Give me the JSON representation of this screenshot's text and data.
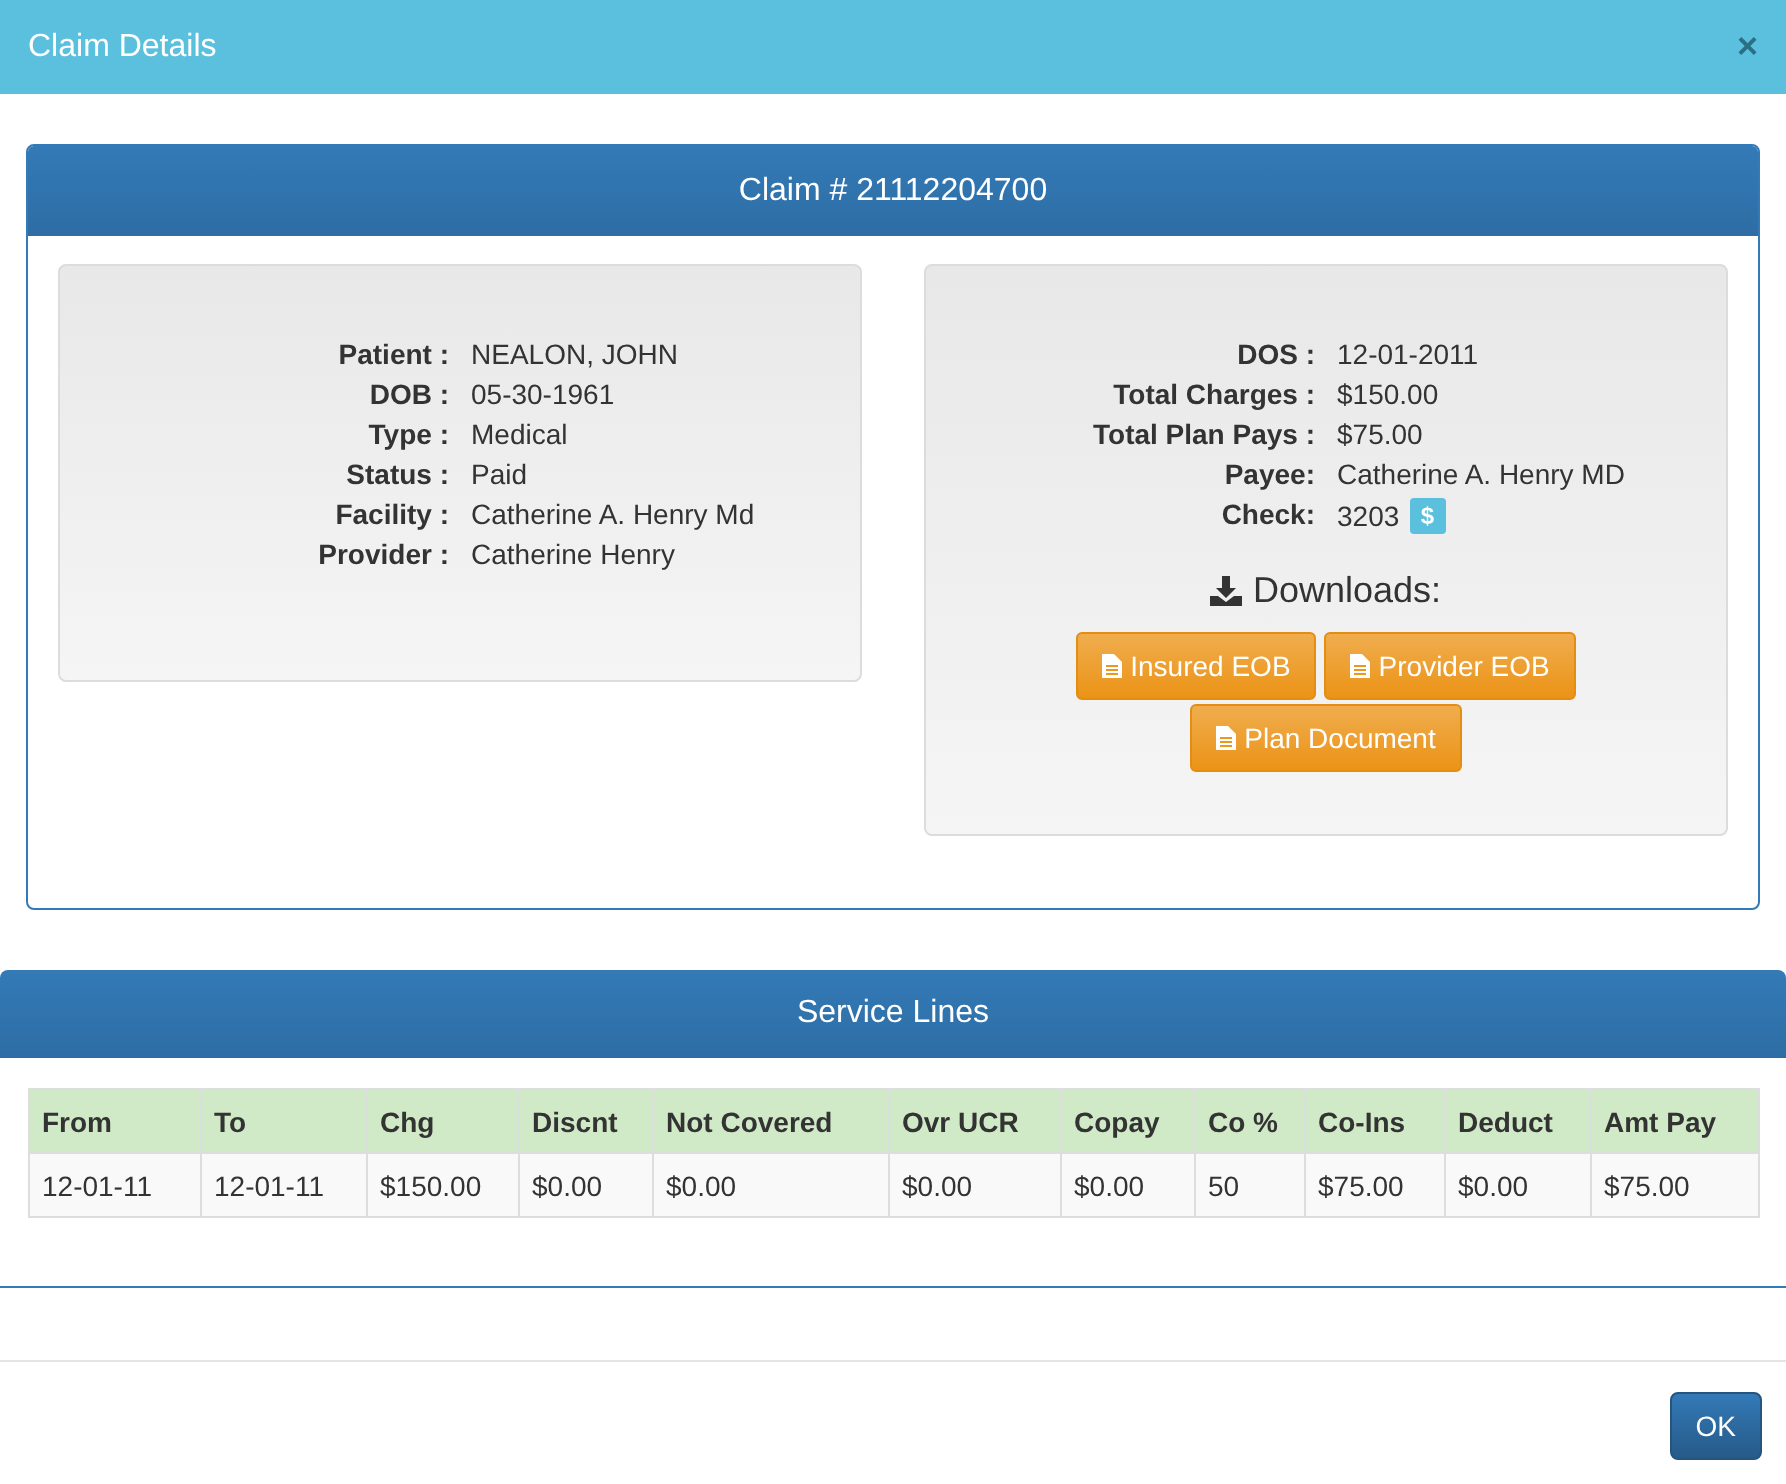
{
  "window": {
    "title": "Claim Details",
    "close": "×"
  },
  "claim": {
    "title": "Claim # 21112204700",
    "left_fields": [
      {
        "label": "Patient :",
        "value": "NEALON, JOHN"
      },
      {
        "label": "DOB :",
        "value": "05-30-1961"
      },
      {
        "label": "Type :",
        "value": "Medical"
      },
      {
        "label": "Status :",
        "value": "Paid"
      },
      {
        "label": "Facility :",
        "value": "Catherine A. Henry Md"
      },
      {
        "label": "Provider :",
        "value": "Catherine Henry"
      }
    ],
    "right_fields": [
      {
        "label": "DOS :",
        "value": "12-01-2011"
      },
      {
        "label": "Total Charges :",
        "value": "$150.00"
      },
      {
        "label": "Total Plan Pays :",
        "value": "$75.00"
      },
      {
        "label": "Payee:",
        "value": "Catherine A. Henry MD"
      },
      {
        "label": "Check:",
        "value": "3203",
        "badge": "$"
      }
    ],
    "downloads": {
      "title": "Downloads:",
      "buttons": [
        "Insured EOB",
        "Provider EOB",
        "Plan Document"
      ]
    }
  },
  "service_lines": {
    "title": "Service Lines",
    "columns": [
      "From",
      "To",
      "Chg",
      "Discnt",
      "Not Covered",
      "Ovr UCR",
      "Copay",
      "Co %",
      "Co-Ins",
      "Deduct",
      "Amt Pay"
    ],
    "rows": [
      [
        "12-01-11",
        "12-01-11",
        "$150.00",
        "$0.00",
        "$0.00",
        "$0.00",
        "$0.00",
        "50",
        "$75.00",
        "$0.00",
        "$75.00"
      ]
    ]
  },
  "footer": {
    "buttons": [
      "OK"
    ]
  }
}
